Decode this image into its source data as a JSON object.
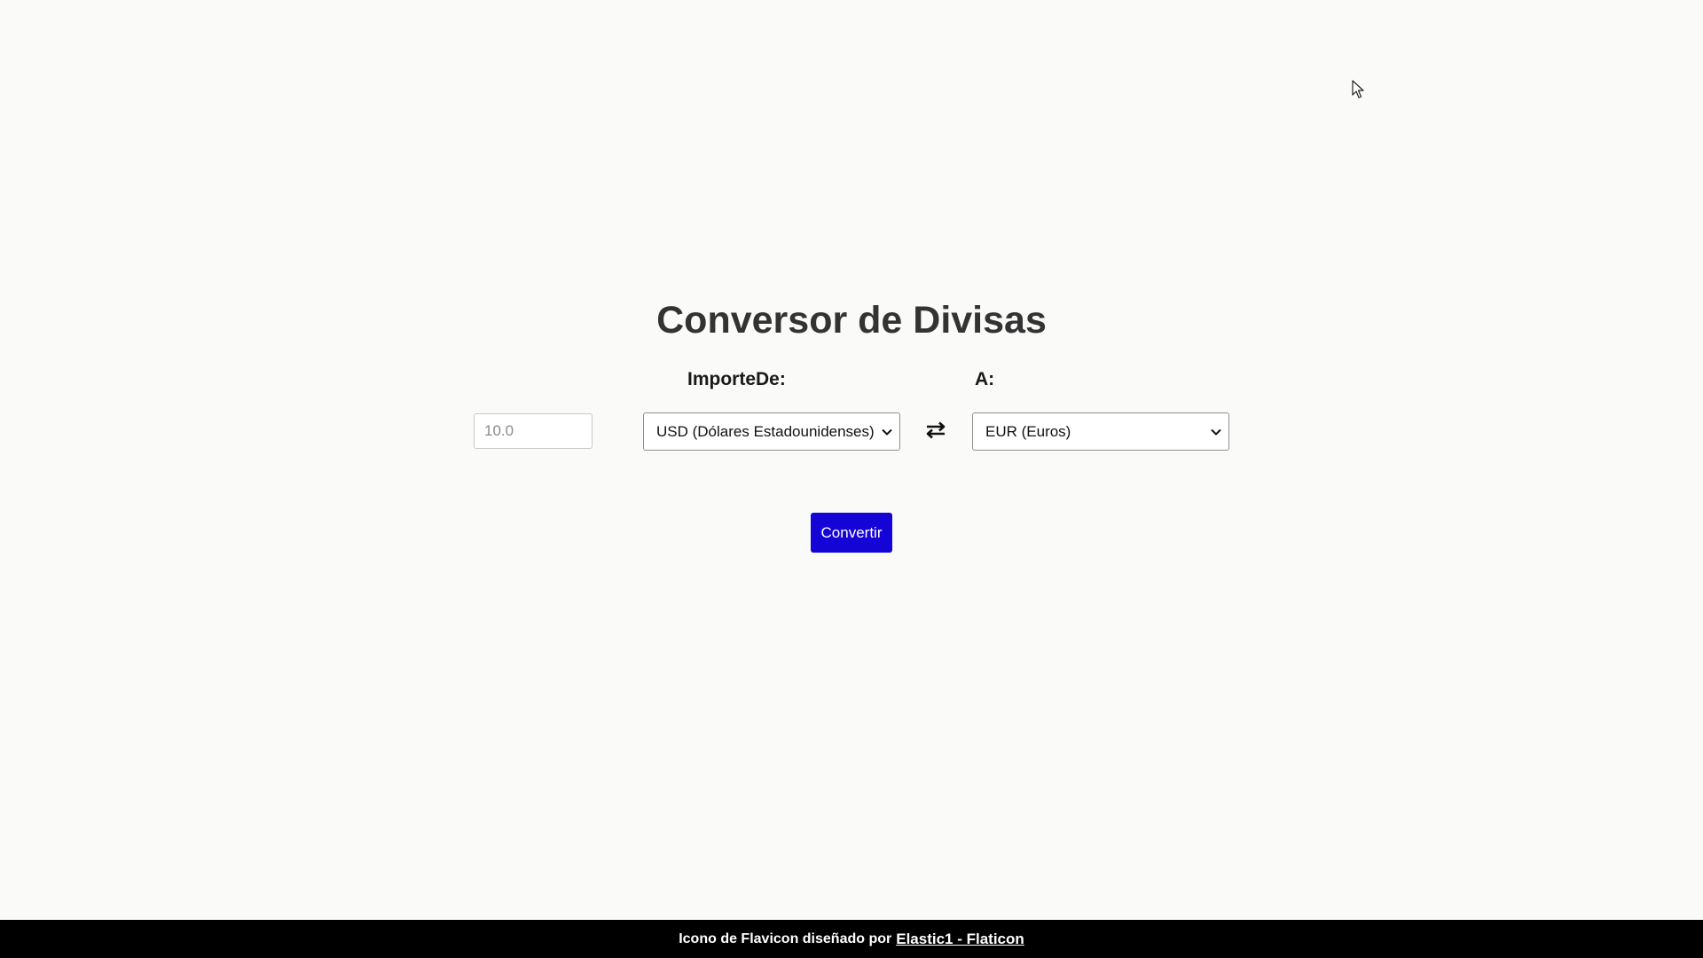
{
  "main": {
    "title": "Conversor de Divisas",
    "from_label": "ImporteDe:",
    "to_label": "A:",
    "amount_placeholder": "10.0",
    "from_currency": "USD (Dólares Estadounidenses)",
    "to_currency": "EUR (Euros)",
    "convert_label": "Convertir",
    "swap_icon": "swap-arrows-icon",
    "dropdown_icon": "chevron-down-icon"
  },
  "footer": {
    "credit_text": "Icono de Flavicon diseñado por",
    "credit_link": "Elastic1 - Flaticon"
  },
  "colors": {
    "background": "#fafaf9",
    "primary_button": "#1404d6",
    "footer_bg": "#000000"
  }
}
